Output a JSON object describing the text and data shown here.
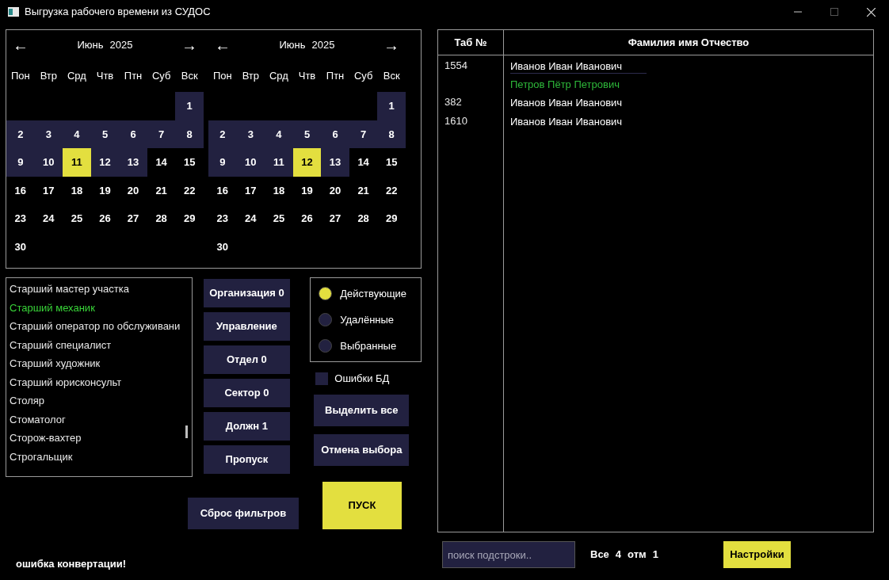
{
  "window": {
    "title": "Выгрузка рабочего времени из СУДОС"
  },
  "calendars": [
    {
      "prev": "←",
      "next": "→",
      "month": "Июнь",
      "year": "2025",
      "weekdays": [
        "Пон",
        "Втр",
        "Срд",
        "Чтв",
        "Птн",
        "Суб",
        "Вск"
      ],
      "weeks": [
        [
          {
            "day": "1",
            "in_range": true,
            "selected": false
          }
        ],
        [
          {
            "day": "2",
            "in_range": true,
            "selected": false
          },
          {
            "day": "3",
            "in_range": true,
            "selected": false
          },
          {
            "day": "4",
            "in_range": true,
            "selected": false
          },
          {
            "day": "5",
            "in_range": true,
            "selected": false
          },
          {
            "day": "6",
            "in_range": true,
            "selected": false
          },
          {
            "day": "7",
            "in_range": true,
            "selected": false
          },
          {
            "day": "8",
            "in_range": true,
            "selected": false
          }
        ],
        [
          {
            "day": "9",
            "in_range": true,
            "selected": false
          },
          {
            "day": "10",
            "in_range": true,
            "selected": false
          },
          {
            "day": "11",
            "selected": true
          },
          {
            "day": "12",
            "in_range": true,
            "selected": false
          },
          {
            "day": "13",
            "in_range": true,
            "selected": false
          },
          {
            "day": "14",
            "in_range": false,
            "selected": false
          },
          {
            "day": "15",
            "in_range": false,
            "selected": false
          }
        ],
        [
          {
            "day": "16",
            "in_range": false,
            "selected": false
          },
          {
            "day": "17",
            "in_range": false,
            "selected": false
          },
          {
            "day": "18",
            "in_range": false,
            "selected": false
          },
          {
            "day": "19",
            "in_range": false,
            "selected": false
          },
          {
            "day": "20",
            "in_range": false,
            "selected": false
          },
          {
            "day": "21",
            "in_range": false,
            "selected": false
          },
          {
            "day": "22",
            "in_range": false,
            "selected": false
          }
        ],
        [
          {
            "day": "23",
            "in_range": false,
            "selected": false
          },
          {
            "day": "24",
            "in_range": false,
            "selected": false
          },
          {
            "day": "25",
            "in_range": false,
            "selected": false
          },
          {
            "day": "26",
            "in_range": false,
            "selected": false
          },
          {
            "day": "27",
            "in_range": false,
            "selected": false
          },
          {
            "day": "28",
            "in_range": false,
            "selected": false
          },
          {
            "day": "29",
            "in_range": false,
            "selected": false
          }
        ],
        [
          {
            "day": "30",
            "in_range": false,
            "selected": false
          }
        ]
      ]
    },
    {
      "prev": "←",
      "next": "→",
      "month": "Июнь",
      "year": "2025",
      "weekdays": [
        "Пон",
        "Втр",
        "Срд",
        "Чтв",
        "Птн",
        "Суб",
        "Вск"
      ],
      "weeks": [
        [
          {
            "day": "1",
            "in_range": true,
            "selected": false
          }
        ],
        [
          {
            "day": "2",
            "in_range": true,
            "selected": false
          },
          {
            "day": "3",
            "in_range": true,
            "selected": false
          },
          {
            "day": "4",
            "in_range": true,
            "selected": false
          },
          {
            "day": "5",
            "in_range": true,
            "selected": false
          },
          {
            "day": "6",
            "in_range": true,
            "selected": false
          },
          {
            "day": "7",
            "in_range": true,
            "selected": false
          },
          {
            "day": "8",
            "in_range": true,
            "selected": false
          }
        ],
        [
          {
            "day": "9",
            "in_range": true,
            "selected": false
          },
          {
            "day": "10",
            "in_range": true,
            "selected": false
          },
          {
            "day": "11",
            "in_range": true,
            "selected": false
          },
          {
            "day": "12",
            "selected": true
          },
          {
            "day": "13",
            "in_range": true,
            "selected": false
          },
          {
            "day": "14",
            "in_range": false,
            "selected": false
          },
          {
            "day": "15",
            "in_range": false,
            "selected": false
          }
        ],
        [
          {
            "day": "16",
            "in_range": false,
            "selected": false
          },
          {
            "day": "17",
            "in_range": false,
            "selected": false
          },
          {
            "day": "18",
            "in_range": false,
            "selected": false
          },
          {
            "day": "19",
            "in_range": false,
            "selected": false
          },
          {
            "day": "20",
            "in_range": false,
            "selected": false
          },
          {
            "day": "21",
            "in_range": false,
            "selected": false
          },
          {
            "day": "22",
            "in_range": false,
            "selected": false
          }
        ],
        [
          {
            "day": "23",
            "in_range": false,
            "selected": false
          },
          {
            "day": "24",
            "in_range": false,
            "selected": false
          },
          {
            "day": "25",
            "in_range": false,
            "selected": false
          },
          {
            "day": "26",
            "in_range": false,
            "selected": false
          },
          {
            "day": "27",
            "in_range": false,
            "selected": false
          },
          {
            "day": "28",
            "in_range": false,
            "selected": false
          },
          {
            "day": "29",
            "in_range": false,
            "selected": false
          }
        ],
        [
          {
            "day": "30",
            "in_range": false,
            "selected": false
          }
        ]
      ]
    }
  ],
  "positions": [
    {
      "label": "Старший мастер участка",
      "selected": false
    },
    {
      "label": "Старший механик",
      "selected": true
    },
    {
      "label": "Старший оператор по обслуживани",
      "selected": false
    },
    {
      "label": "Старший специалист",
      "selected": false
    },
    {
      "label": "Старший художник",
      "selected": false
    },
    {
      "label": "Старший юрисконсульт",
      "selected": false
    },
    {
      "label": "Столяр",
      "selected": false
    },
    {
      "label": "Стоматолог",
      "selected": false
    },
    {
      "label": "Сторож-вахтер",
      "selected": false
    },
    {
      "label": "Строгальщик",
      "selected": false
    }
  ],
  "filter_buttons": [
    "Организация 0",
    "Управление",
    "Отдел 0",
    "Сектор 0",
    "Должн 1",
    "Пропуск"
  ],
  "status_options": [
    {
      "label": "Действующие",
      "selected": true
    },
    {
      "label": "Удалённые",
      "selected": false
    },
    {
      "label": "Выбранные",
      "selected": false
    }
  ],
  "db_errors": {
    "label": "Ошибки БД",
    "checked": false
  },
  "select_all_button": "Выделить все",
  "deselect_button": "Отмена выбора",
  "reset_button": "Сброс фильтров",
  "start_button": "ПУСК",
  "error_message": "ошибка конвертации!",
  "table": {
    "columns": [
      "Таб №",
      "Фамилия имя Отчество"
    ],
    "rows": [
      {
        "tab": "1554",
        "names": [
          {
            "text": "Иванов Иван Иванович",
            "selected": false
          },
          {
            "text": "Петров Пётр Петрович",
            "selected": true
          }
        ]
      },
      {
        "tab": "382",
        "names": [
          {
            "text": "Иванов Иван Иванович",
            "selected": false
          }
        ]
      },
      {
        "tab": "1610",
        "names": [
          {
            "text": "Иванов Иван Иванович",
            "selected": false
          }
        ]
      }
    ]
  },
  "search": {
    "placeholder": "поиск подстроки.."
  },
  "counts": {
    "all_label": "Все",
    "all": "4",
    "marked_label": "отм",
    "marked": "1"
  },
  "settings_button": "Настройки"
}
